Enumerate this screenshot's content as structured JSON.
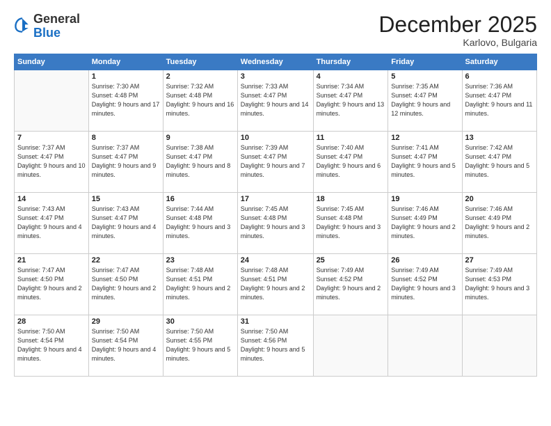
{
  "header": {
    "logo_general": "General",
    "logo_blue": "Blue",
    "month_title": "December 2025",
    "location": "Karlovo, Bulgaria"
  },
  "weekdays": [
    "Sunday",
    "Monday",
    "Tuesday",
    "Wednesday",
    "Thursday",
    "Friday",
    "Saturday"
  ],
  "weeks": [
    [
      {
        "day": "",
        "sunrise": "",
        "sunset": "",
        "daylight": ""
      },
      {
        "day": "1",
        "sunrise": "Sunrise: 7:30 AM",
        "sunset": "Sunset: 4:48 PM",
        "daylight": "Daylight: 9 hours and 17 minutes."
      },
      {
        "day": "2",
        "sunrise": "Sunrise: 7:32 AM",
        "sunset": "Sunset: 4:48 PM",
        "daylight": "Daylight: 9 hours and 16 minutes."
      },
      {
        "day": "3",
        "sunrise": "Sunrise: 7:33 AM",
        "sunset": "Sunset: 4:47 PM",
        "daylight": "Daylight: 9 hours and 14 minutes."
      },
      {
        "day": "4",
        "sunrise": "Sunrise: 7:34 AM",
        "sunset": "Sunset: 4:47 PM",
        "daylight": "Daylight: 9 hours and 13 minutes."
      },
      {
        "day": "5",
        "sunrise": "Sunrise: 7:35 AM",
        "sunset": "Sunset: 4:47 PM",
        "daylight": "Daylight: 9 hours and 12 minutes."
      },
      {
        "day": "6",
        "sunrise": "Sunrise: 7:36 AM",
        "sunset": "Sunset: 4:47 PM",
        "daylight": "Daylight: 9 hours and 11 minutes."
      }
    ],
    [
      {
        "day": "7",
        "sunrise": "Sunrise: 7:37 AM",
        "sunset": "Sunset: 4:47 PM",
        "daylight": "Daylight: 9 hours and 10 minutes."
      },
      {
        "day": "8",
        "sunrise": "Sunrise: 7:37 AM",
        "sunset": "Sunset: 4:47 PM",
        "daylight": "Daylight: 9 hours and 9 minutes."
      },
      {
        "day": "9",
        "sunrise": "Sunrise: 7:38 AM",
        "sunset": "Sunset: 4:47 PM",
        "daylight": "Daylight: 9 hours and 8 minutes."
      },
      {
        "day": "10",
        "sunrise": "Sunrise: 7:39 AM",
        "sunset": "Sunset: 4:47 PM",
        "daylight": "Daylight: 9 hours and 7 minutes."
      },
      {
        "day": "11",
        "sunrise": "Sunrise: 7:40 AM",
        "sunset": "Sunset: 4:47 PM",
        "daylight": "Daylight: 9 hours and 6 minutes."
      },
      {
        "day": "12",
        "sunrise": "Sunrise: 7:41 AM",
        "sunset": "Sunset: 4:47 PM",
        "daylight": "Daylight: 9 hours and 5 minutes."
      },
      {
        "day": "13",
        "sunrise": "Sunrise: 7:42 AM",
        "sunset": "Sunset: 4:47 PM",
        "daylight": "Daylight: 9 hours and 5 minutes."
      }
    ],
    [
      {
        "day": "14",
        "sunrise": "Sunrise: 7:43 AM",
        "sunset": "Sunset: 4:47 PM",
        "daylight": "Daylight: 9 hours and 4 minutes."
      },
      {
        "day": "15",
        "sunrise": "Sunrise: 7:43 AM",
        "sunset": "Sunset: 4:47 PM",
        "daylight": "Daylight: 9 hours and 4 minutes."
      },
      {
        "day": "16",
        "sunrise": "Sunrise: 7:44 AM",
        "sunset": "Sunset: 4:48 PM",
        "daylight": "Daylight: 9 hours and 3 minutes."
      },
      {
        "day": "17",
        "sunrise": "Sunrise: 7:45 AM",
        "sunset": "Sunset: 4:48 PM",
        "daylight": "Daylight: 9 hours and 3 minutes."
      },
      {
        "day": "18",
        "sunrise": "Sunrise: 7:45 AM",
        "sunset": "Sunset: 4:48 PM",
        "daylight": "Daylight: 9 hours and 3 minutes."
      },
      {
        "day": "19",
        "sunrise": "Sunrise: 7:46 AM",
        "sunset": "Sunset: 4:49 PM",
        "daylight": "Daylight: 9 hours and 2 minutes."
      },
      {
        "day": "20",
        "sunrise": "Sunrise: 7:46 AM",
        "sunset": "Sunset: 4:49 PM",
        "daylight": "Daylight: 9 hours and 2 minutes."
      }
    ],
    [
      {
        "day": "21",
        "sunrise": "Sunrise: 7:47 AM",
        "sunset": "Sunset: 4:50 PM",
        "daylight": "Daylight: 9 hours and 2 minutes."
      },
      {
        "day": "22",
        "sunrise": "Sunrise: 7:47 AM",
        "sunset": "Sunset: 4:50 PM",
        "daylight": "Daylight: 9 hours and 2 minutes."
      },
      {
        "day": "23",
        "sunrise": "Sunrise: 7:48 AM",
        "sunset": "Sunset: 4:51 PM",
        "daylight": "Daylight: 9 hours and 2 minutes."
      },
      {
        "day": "24",
        "sunrise": "Sunrise: 7:48 AM",
        "sunset": "Sunset: 4:51 PM",
        "daylight": "Daylight: 9 hours and 2 minutes."
      },
      {
        "day": "25",
        "sunrise": "Sunrise: 7:49 AM",
        "sunset": "Sunset: 4:52 PM",
        "daylight": "Daylight: 9 hours and 2 minutes."
      },
      {
        "day": "26",
        "sunrise": "Sunrise: 7:49 AM",
        "sunset": "Sunset: 4:52 PM",
        "daylight": "Daylight: 9 hours and 3 minutes."
      },
      {
        "day": "27",
        "sunrise": "Sunrise: 7:49 AM",
        "sunset": "Sunset: 4:53 PM",
        "daylight": "Daylight: 9 hours and 3 minutes."
      }
    ],
    [
      {
        "day": "28",
        "sunrise": "Sunrise: 7:50 AM",
        "sunset": "Sunset: 4:54 PM",
        "daylight": "Daylight: 9 hours and 4 minutes."
      },
      {
        "day": "29",
        "sunrise": "Sunrise: 7:50 AM",
        "sunset": "Sunset: 4:54 PM",
        "daylight": "Daylight: 9 hours and 4 minutes."
      },
      {
        "day": "30",
        "sunrise": "Sunrise: 7:50 AM",
        "sunset": "Sunset: 4:55 PM",
        "daylight": "Daylight: 9 hours and 5 minutes."
      },
      {
        "day": "31",
        "sunrise": "Sunrise: 7:50 AM",
        "sunset": "Sunset: 4:56 PM",
        "daylight": "Daylight: 9 hours and 5 minutes."
      },
      {
        "day": "",
        "sunrise": "",
        "sunset": "",
        "daylight": ""
      },
      {
        "day": "",
        "sunrise": "",
        "sunset": "",
        "daylight": ""
      },
      {
        "day": "",
        "sunrise": "",
        "sunset": "",
        "daylight": ""
      }
    ]
  ]
}
